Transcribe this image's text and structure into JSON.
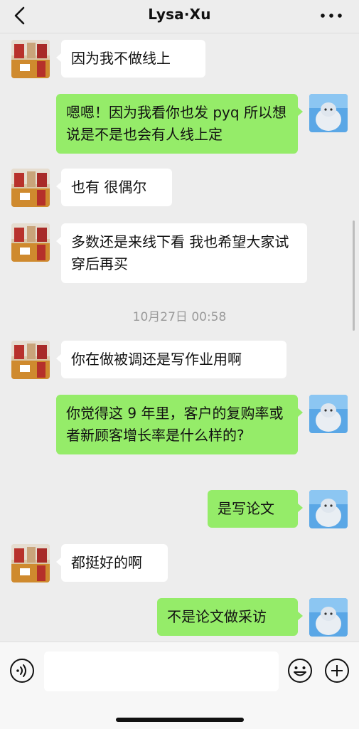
{
  "header": {
    "title": "Lysa·Xu"
  },
  "messages": [
    {
      "side": "friend",
      "text": "因为我不做线上"
    },
    {
      "side": "me",
      "text": "嗯嗯！因为我看你也发 pyq 所以想说是不是也会有人线上定"
    },
    {
      "side": "friend",
      "text": "也有 很偶尔"
    },
    {
      "side": "friend",
      "text": "多数还是来线下看 我也希望大家试穿后再买"
    },
    {
      "side": "time",
      "text": "10月27日 00:58"
    },
    {
      "side": "friend",
      "text": "你在做被调还是写作业用啊"
    },
    {
      "side": "me",
      "text": "你觉得这 9 年里，客户的复购率或者新顾客增长率是什么样的?"
    },
    {
      "side": "me",
      "text": "是写论文"
    },
    {
      "side": "friend",
      "text": "都挺好的啊"
    },
    {
      "side": "me",
      "text": "不是论文做采访"
    }
  ],
  "input": {
    "value": "",
    "placeholder": ""
  },
  "icons": {
    "back": "chevron-left-icon",
    "more": "more-dots-icon",
    "voice": "voice-icon",
    "emoji": "emoji-icon",
    "plus": "plus-icon"
  },
  "colors": {
    "background": "#ededed",
    "my_bubble": "#95ec69",
    "friend_bubble": "#ffffff",
    "timestamp": "#9a9a9a"
  }
}
